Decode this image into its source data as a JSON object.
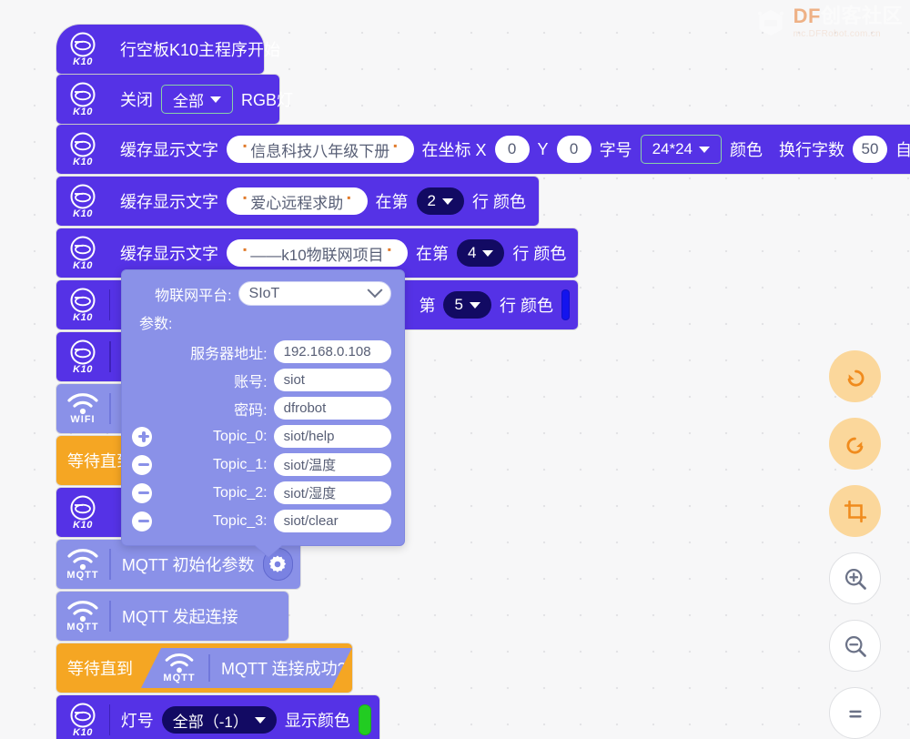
{
  "watermark": {
    "brand": "DF",
    "brand_cn": "创客社区",
    "url": "mc.DFRobot.com.cn",
    "logo_icon": "hexagon-robot-icon"
  },
  "blocks": [
    {
      "id": "hat",
      "icon": "k10-icon",
      "icon_label": "K10",
      "label": "行空板K10主程序开始"
    },
    {
      "id": "rgb-off",
      "icon": "k10-icon",
      "icon_label": "K10",
      "label_1": "关闭",
      "dropdown": "全部",
      "label_2": "RGB灯"
    },
    {
      "id": "cache-text-xy",
      "icon": "k10-icon",
      "icon_label": "K10",
      "label_1": "缓存显示文字",
      "text_value": "信息科技八年级下册",
      "label_2": "在坐标 X",
      "x_value": "0",
      "label_3": "Y",
      "y_value": "0",
      "label_4": "字号",
      "font_size": "24*24",
      "label_5": "颜色",
      "color": "#000000",
      "label_6": "换行字数",
      "wrap_value": "50",
      "label_7": "自动清"
    },
    {
      "id": "cache-text-line-2",
      "icon": "k10-icon",
      "icon_label": "K10",
      "label_1": "缓存显示文字",
      "text_value": "爱心远程求助",
      "label_2": "在第",
      "line": "2",
      "label_3": "行 颜色",
      "color": "#ee1111"
    },
    {
      "id": "cache-text-line-4",
      "icon": "k10-icon",
      "icon_label": "K10",
      "label_1": "缓存显示文字",
      "text_value": "——k10物联网项目",
      "label_2": "在第",
      "line": "4",
      "label_3": "行 颜色",
      "color": "#1414ee"
    },
    {
      "id": "cache-text-line-5",
      "icon": "k10-icon",
      "icon_label": "K10",
      "label_2": "第",
      "line": "5",
      "label_3": "行 颜色",
      "color": "#1414ee"
    },
    {
      "id": "hidden-k10-row",
      "icon": "k10-icon",
      "icon_label": "K10"
    },
    {
      "id": "wifi-connect",
      "icon": "wifi-icon",
      "icon_label": "WIFI"
    },
    {
      "id": "wait-until-wifi",
      "label_1": "等待直到"
    },
    {
      "id": "hidden-k10-row-2",
      "icon": "k10-icon",
      "icon_label": "K10"
    },
    {
      "id": "mqtt-init",
      "icon": "mqtt-icon",
      "icon_label": "MQTT",
      "label_1": "MQTT 初始化参数",
      "gear": "gear-icon"
    },
    {
      "id": "mqtt-connect",
      "icon": "mqtt-icon",
      "icon_label": "MQTT",
      "label_1": "MQTT 发起连接"
    },
    {
      "id": "wait-until-mqtt",
      "label_1": "等待直到",
      "icon": "mqtt-icon",
      "icon_label": "MQTT",
      "condition": "MQTT 连接成功?"
    },
    {
      "id": "rgb-show",
      "icon": "k10-icon",
      "icon_label": "K10",
      "label_1": "灯号",
      "dropdown": "全部（-1）",
      "label_2": "显示颜色",
      "color": "#22cc22"
    }
  ],
  "popup": {
    "platform_label": "物联网平台:",
    "platform_value": "SIoT",
    "params_label": "参数:",
    "fields": [
      {
        "label": "服务器地址:",
        "value": "192.168.0.108",
        "btn": "none"
      },
      {
        "label": "账号:",
        "value": "siot",
        "btn": "none"
      },
      {
        "label": "密码:",
        "value": "dfrobot",
        "btn": "none"
      },
      {
        "label": "Topic_0:",
        "value": "siot/help",
        "btn": "plus"
      },
      {
        "label": "Topic_1:",
        "value": "siot/温度",
        "btn": "minus"
      },
      {
        "label": "Topic_2:",
        "value": "siot/湿度",
        "btn": "minus"
      },
      {
        "label": "Topic_3:",
        "value": "siot/clear",
        "btn": "minus"
      }
    ]
  },
  "toolbar": [
    {
      "id": "undo",
      "icon": "undo-icon",
      "style": "amber"
    },
    {
      "id": "redo",
      "icon": "redo-icon",
      "style": "amber"
    },
    {
      "id": "fit",
      "icon": "crop-icon",
      "style": "amber"
    },
    {
      "id": "zoom-in",
      "icon": "zoom-in-icon",
      "style": "plain"
    },
    {
      "id": "zoom-out",
      "icon": "zoom-out-icon",
      "style": "plain"
    },
    {
      "id": "zoom-reset",
      "icon": "equals-icon",
      "style": "plain"
    }
  ]
}
